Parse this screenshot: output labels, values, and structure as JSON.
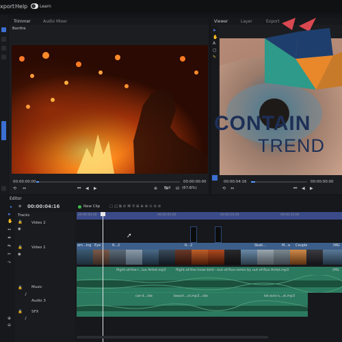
{
  "menu": {
    "export_label": "xport",
    "help_label": "Help",
    "learn_label": "Learn"
  },
  "trimmer": {
    "tabs": [
      "Trimmer",
      "Audio Mixer"
    ],
    "clip_name": "Bonfire",
    "time_start": "00:00:00:00",
    "time_end": "00:00:00:00"
  },
  "viewer": {
    "tabs": [
      "Viewer",
      "Layer",
      "Export"
    ],
    "time_current": "00:00:04:16",
    "time_end": "00:00:00:00",
    "zoom_label": "Full",
    "zoom_percent": "(67.6%)"
  },
  "watermark": {
    "line1": "CONTAIN",
    "line2": "TREND"
  },
  "editor": {
    "tab": "Editor",
    "timecode": "00:00:04:16",
    "new_clip_label": "New Clip",
    "tracks_label": "Tracks",
    "ruler": [
      "00:00:00:00",
      "00:00:05:00",
      "00:00:10:00",
      "00:00:15:00",
      "00:00:20:00"
    ]
  },
  "tracks": [
    {
      "name": "Video 2"
    },
    {
      "name": "Video 1"
    },
    {
      "name": "Music"
    },
    {
      "name": "SFX"
    },
    {
      "name": "Audio 3"
    }
  ],
  "video1_clips": [
    "om...ing",
    "Eye",
    "R...2",
    "R...2",
    "Skati...",
    "M...e",
    "Couple",
    "IMG"
  ],
  "music_clips": [
    "flight-of-the-i...lux Artist.mp3",
    "flight-of-the-inner-bird---out-of-flux-remix by out-of-flux Artist.mp3",
    "(MG"
  ],
  "sfx_clips": [
    "car-d...ide",
    "beach...st.mp3...ide",
    "tel-aviv-s...st.mp3"
  ],
  "colors": {
    "accent": "#5a9bff",
    "video_track": "#3c5e8a",
    "audio_track": "#2f8c6b",
    "playhead": "#e8e8e8"
  }
}
